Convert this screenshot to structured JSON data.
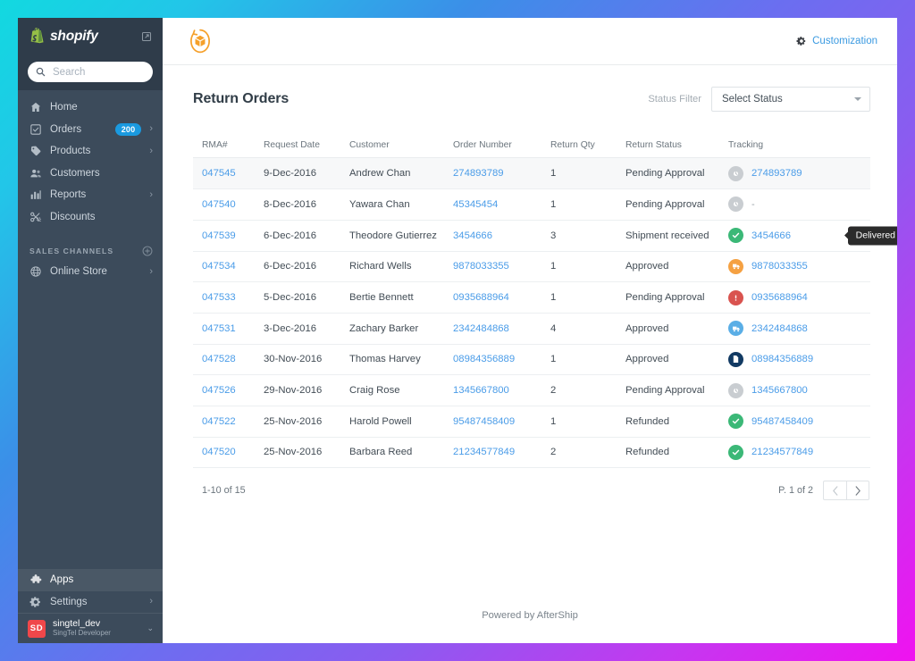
{
  "sidebar": {
    "brand": {
      "name": "shopify",
      "bag_icon": "shopify-bag-icon",
      "external_icon": "external-link-icon"
    },
    "search": {
      "placeholder": "Search",
      "value": "",
      "icon": "search-icon"
    },
    "nav": [
      {
        "label": "Home",
        "icon": "home-icon",
        "badge": "",
        "chevron": ""
      },
      {
        "label": "Orders",
        "icon": "orders-checkbox-icon",
        "badge": "200",
        "chevron": "›"
      },
      {
        "label": "Products",
        "icon": "tag-icon",
        "badge": "",
        "chevron": "›"
      },
      {
        "label": "Customers",
        "icon": "customers-icon",
        "badge": "",
        "chevron": ""
      },
      {
        "label": "Reports",
        "icon": "bar-chart-icon",
        "badge": "",
        "chevron": "›"
      },
      {
        "label": "Discounts",
        "icon": "scissors-icon",
        "badge": "",
        "chevron": ""
      }
    ],
    "section": {
      "label": "SALES CHANNELS",
      "add_icon": "plus-circle-icon"
    },
    "channels": [
      {
        "label": "Online Store",
        "icon": "globe-icon",
        "chevron": "›"
      }
    ],
    "bottom": [
      {
        "label": "Apps",
        "icon": "puzzle-icon",
        "chevron": "",
        "active": true
      },
      {
        "label": "Settings",
        "icon": "gear-icon",
        "chevron": "›",
        "active": false
      }
    ],
    "user": {
      "initials": "SD",
      "name": "singtel_dev",
      "role": "SingTel Developer",
      "caret": "⌄"
    }
  },
  "topbar": {
    "logo_icon": "aftership-returns-box-icon",
    "customization_label": "Customization",
    "customization_icon": "gear-icon",
    "accent_color": "#3b9ae1",
    "logo_color": "#f5a02a"
  },
  "page": {
    "title": "Return Orders",
    "filter_label": "Status Filter",
    "filter_value": "Select Status",
    "filter_caret": "caret-down-icon"
  },
  "table": {
    "columns": [
      "RMA#",
      "Request Date",
      "Customer",
      "Order Number",
      "Return Qty",
      "Return Status",
      "Tracking"
    ],
    "rows": [
      {
        "rma": "047545",
        "date": "9-Dec-2016",
        "customer": "Andrew Chan",
        "order": "274893789",
        "qty": "1",
        "status": "Pending Approval",
        "tracking": "274893789",
        "badge": "pending",
        "badge_color": "#c9cdd1",
        "hover": true
      },
      {
        "rma": "047540",
        "date": "8-Dec-2016",
        "customer": "Yawara Chan",
        "order": "45345454",
        "qty": "1",
        "status": "Pending Approval",
        "tracking": "-",
        "badge": "pending",
        "badge_color": "#c9cdd1",
        "hover": false
      },
      {
        "rma": "047539",
        "date": "6-Dec-2016",
        "customer": "Theodore Gutierrez",
        "order": "3454666",
        "qty": "3",
        "status": "Shipment received",
        "tracking": "3454666",
        "badge": "delivered",
        "badge_color": "#3bb877",
        "hover": false,
        "tooltip": "Delivered"
      },
      {
        "rma": "047534",
        "date": "6-Dec-2016",
        "customer": "Richard Wells",
        "order": "9878033355",
        "qty": "1",
        "status": "Approved",
        "tracking": "9878033355",
        "badge": "out-for-delivery",
        "badge_color": "#f5a142",
        "hover": false
      },
      {
        "rma": "047533",
        "date": "5-Dec-2016",
        "customer": "Bertie Bennett",
        "order": "0935688964",
        "qty": "1",
        "status": "Pending Approval",
        "tracking": "0935688964",
        "badge": "exception",
        "badge_color": "#d9534f",
        "hover": false
      },
      {
        "rma": "047531",
        "date": "3-Dec-2016",
        "customer": "Zachary Barker",
        "order": "2342484868",
        "qty": "4",
        "status": "Approved",
        "tracking": "2342484868",
        "badge": "in-transit",
        "badge_color": "#5aaee6",
        "hover": false
      },
      {
        "rma": "047528",
        "date": "30-Nov-2016",
        "customer": "Thomas Harvey",
        "order": "08984356889",
        "qty": "1",
        "status": "Approved",
        "tracking": "08984356889",
        "badge": "info-received",
        "badge_color": "#123a63",
        "hover": false
      },
      {
        "rma": "047526",
        "date": "29-Nov-2016",
        "customer": "Craig Rose",
        "order": "1345667800",
        "qty": "2",
        "status": "Pending Approval",
        "tracking": "1345667800",
        "badge": "pending",
        "badge_color": "#c9cdd1",
        "hover": false
      },
      {
        "rma": "047522",
        "date": "25-Nov-2016",
        "customer": "Harold Powell",
        "order": "95487458409",
        "qty": "1",
        "status": "Refunded",
        "tracking": "95487458409",
        "badge": "delivered",
        "badge_color": "#3bb877",
        "hover": false
      },
      {
        "rma": "047520",
        "date": "25-Nov-2016",
        "customer": "Barbara Reed",
        "order": "21234577849",
        "qty": "2",
        "status": "Refunded",
        "tracking": "21234577849",
        "badge": "delivered",
        "badge_color": "#3bb877",
        "hover": false
      }
    ]
  },
  "pagination": {
    "range": "1-10 of 15",
    "page_label": "P. 1 of 2",
    "prev_icon": "chevron-left-icon",
    "next_icon": "chevron-right-icon"
  },
  "footer": {
    "text": "Powered by AfterShip"
  }
}
